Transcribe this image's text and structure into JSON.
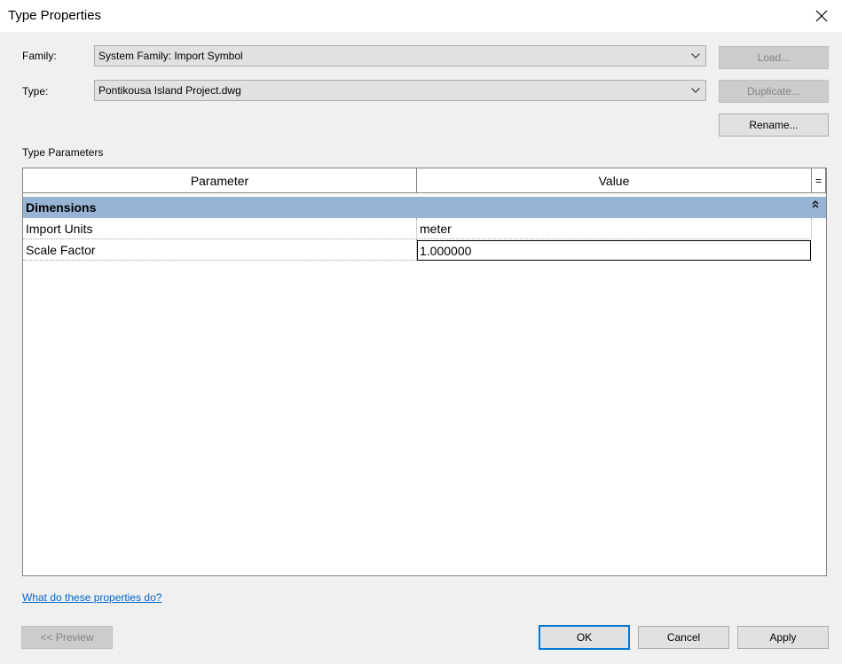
{
  "window": {
    "title": "Type Properties"
  },
  "family": {
    "label": "Family:",
    "value": "System Family: Import Symbol"
  },
  "type": {
    "label": "Type:",
    "value": "Pontikousa Island Project.dwg"
  },
  "buttons": {
    "load": "Load...",
    "duplicate": "Duplicate...",
    "rename": "Rename...",
    "preview": "<< Preview",
    "ok": "OK",
    "cancel": "Cancel",
    "apply": "Apply"
  },
  "type_parameters": {
    "label": "Type Parameters",
    "columns": {
      "parameter": "Parameter",
      "value": "Value",
      "sort": "="
    },
    "groups": [
      {
        "name": "Dimensions",
        "rows": [
          {
            "parameter": "Import Units",
            "value": "meter"
          },
          {
            "parameter": "Scale Factor",
            "value": "1.000000"
          }
        ]
      }
    ]
  },
  "help_link": "What do these properties do?",
  "colors": {
    "group_header": "#98b4d4",
    "link": "#0066cc",
    "default_button_border": "#0078d7"
  }
}
